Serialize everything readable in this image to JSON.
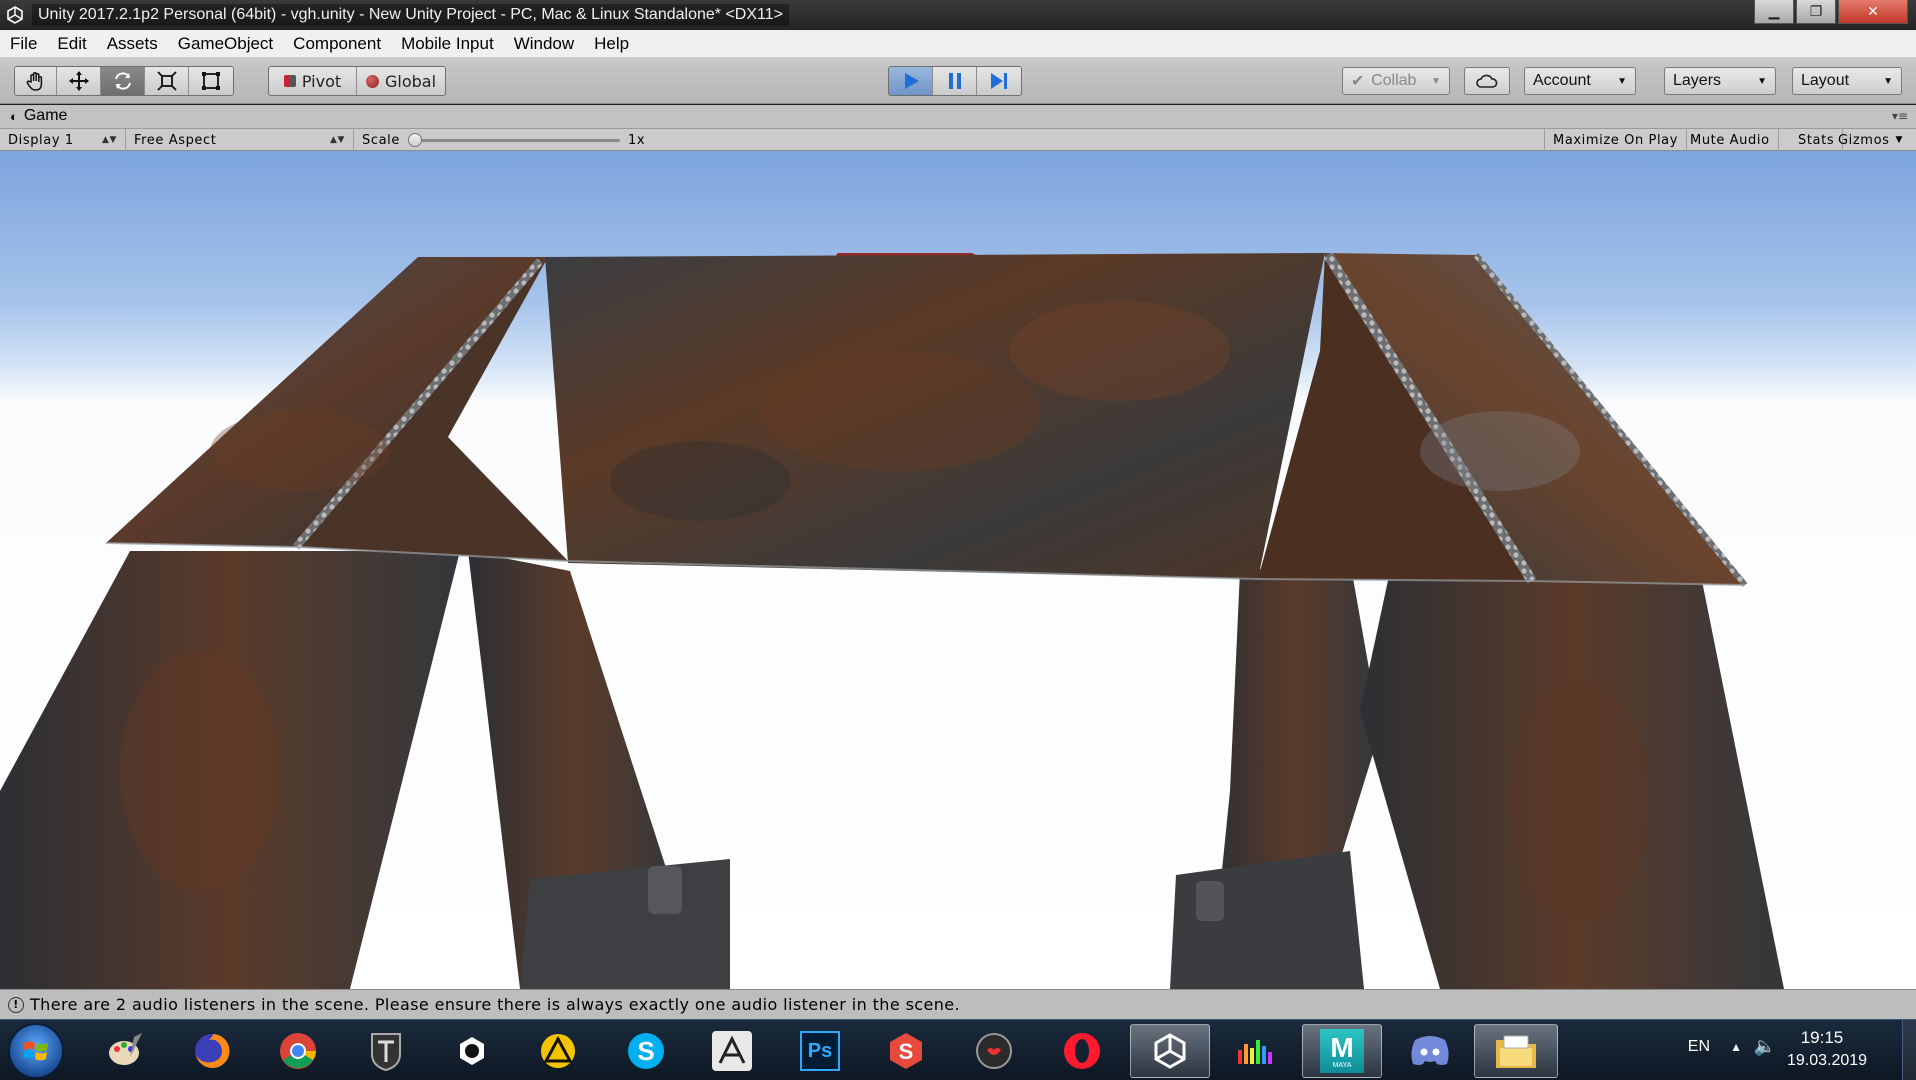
{
  "window": {
    "title": "Unity 2017.2.1p2 Personal (64bit) - vgh.unity - New Unity Project - PC, Mac & Linux Standalone* <DX11>",
    "minimize_icon": "minimize-icon",
    "maximize_icon": "restore-icon",
    "close_icon": "close-icon"
  },
  "menu": [
    "File",
    "Edit",
    "Assets",
    "GameObject",
    "Component",
    "Mobile Input",
    "Window",
    "Help"
  ],
  "toolbar": {
    "tools": [
      "hand-icon",
      "move-icon",
      "rotate-icon",
      "scale-icon",
      "rect-tool-icon"
    ],
    "active_tool": "rotate-icon",
    "pivot_label": "Pivot",
    "global_label": "Global",
    "play_active": true,
    "collab_label": "Collab",
    "account_label": "Account",
    "layers_label": "Layers",
    "layout_label": "Layout"
  },
  "game_tab": {
    "title": "Game"
  },
  "game_controls": {
    "display": "Display 1",
    "aspect": "Free Aspect",
    "scale_label": "Scale",
    "scale_value": "1x",
    "scale_fraction": 0.0,
    "maximize_on_play": "Maximize On Play",
    "mute_audio": "Mute Audio",
    "stats": "Stats",
    "gizmos": "Gizmos"
  },
  "status": {
    "message": "There are 2 audio listeners in the scene. Please ensure there is always exactly one audio listener in the scene."
  },
  "taskbar": {
    "apps": [
      "paint-icon",
      "firefox-icon",
      "chrome-icon",
      "world-of-tanks-icon",
      "quixel-icon",
      "archicad-icon",
      "skype-icon",
      "zbrush-icon",
      "photoshop-icon",
      "substance-painter-icon",
      "marmoset-icon",
      "opera-icon",
      "unity-icon",
      "equalizer-icon",
      "maya-icon",
      "discord-icon",
      "file-explorer-icon"
    ],
    "active_app": "unity-icon",
    "photoshop_text": "Ps",
    "maya_text": "M",
    "maya_sub": "MAYA"
  },
  "tray": {
    "language": "EN",
    "time": "19:15",
    "date": "19.03.2019"
  },
  "colors": {
    "play_blue": "#2a78d8",
    "rust": "#6b3a22",
    "steel": "#3b3f44",
    "sky": "#8fb1e3",
    "taskbar": "#142233"
  }
}
